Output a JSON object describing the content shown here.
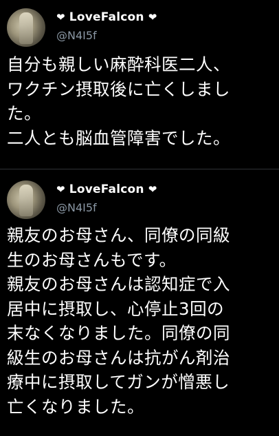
{
  "tweets": [
    {
      "display_name": "LoveFalcon",
      "heart_left": "❤",
      "heart_right": "❤",
      "handle": "@N4I5f",
      "text": "自分も親しい麻酔科医二人、\nワクチン摂取後に亡くしまし\nた。\n二人とも脳血管障害でした。"
    },
    {
      "display_name": "LoveFalcon",
      "heart_left": "❤",
      "heart_right": "❤",
      "handle": "@N4I5f",
      "text": "親友のお母さん、同僚の同級\n生のお母さんもです。\n親友のお母さんは認知症で入\n居中に摂取し、心停止3回の\n末なくなりました。同僚の同\n級生のお母さんは抗がん剤治\n療中に摂取してガンが憎悪し\n亡くなりました。"
    }
  ]
}
